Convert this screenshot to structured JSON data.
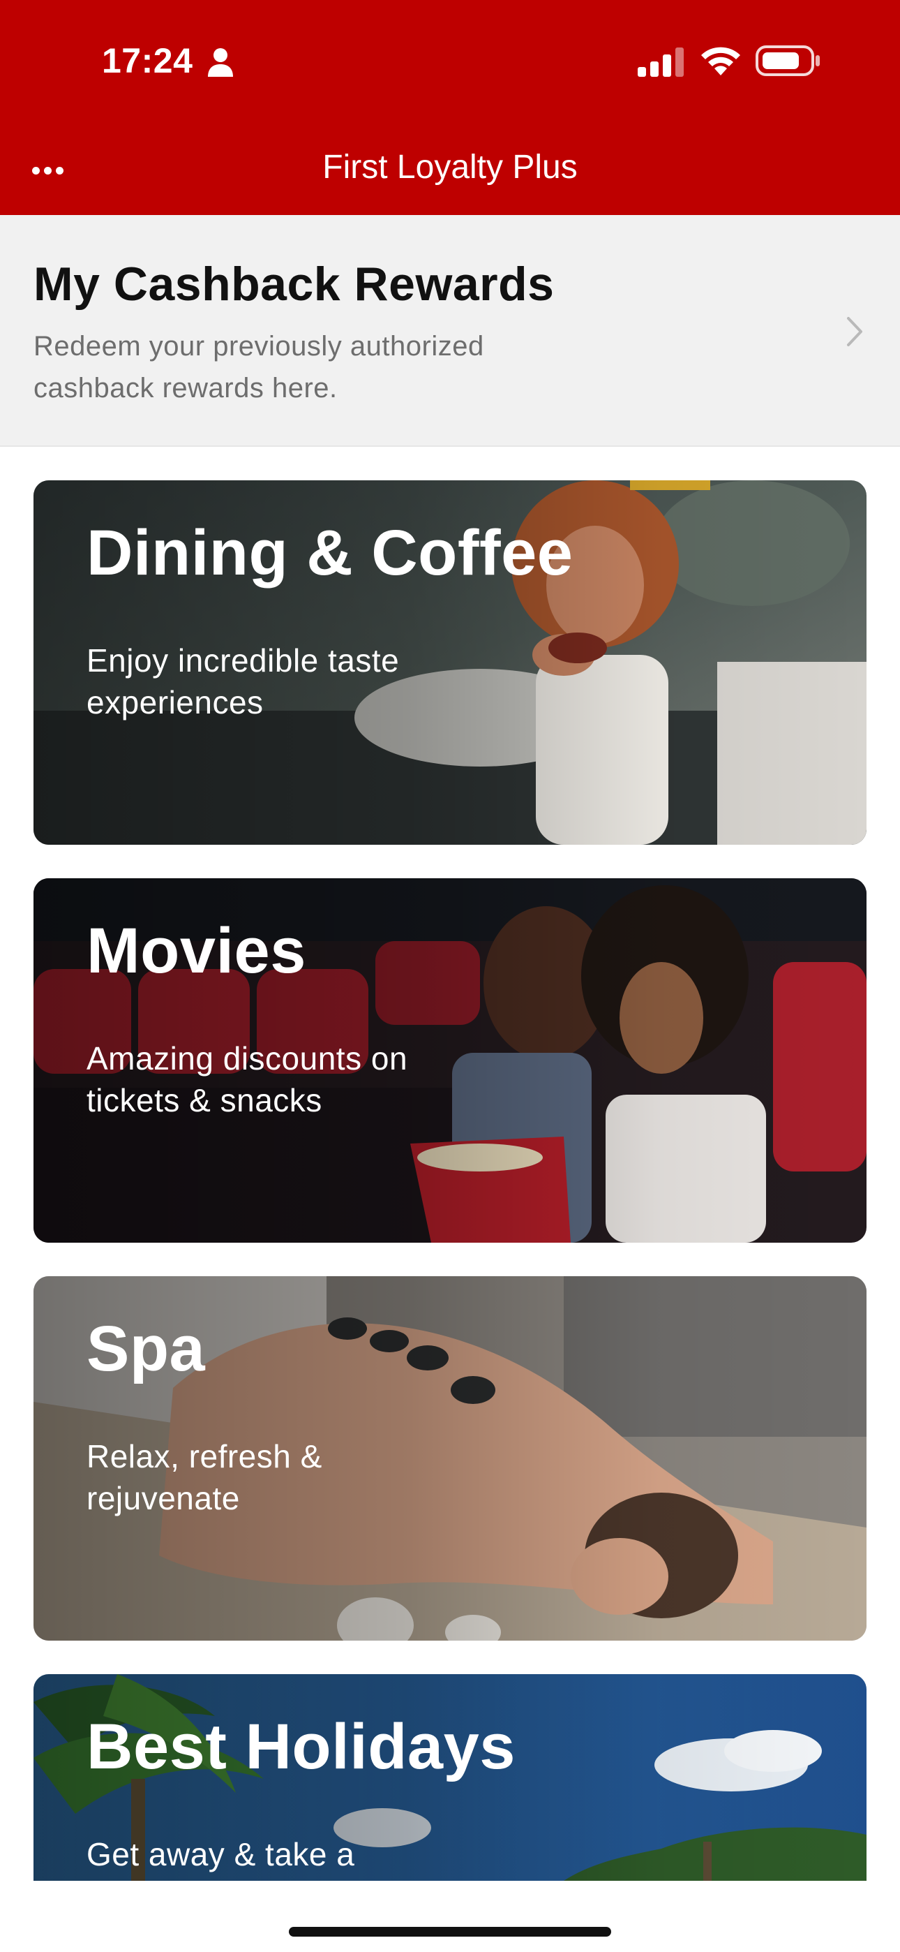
{
  "status_bar": {
    "time": "17:24"
  },
  "header": {
    "title": "First Loyalty Plus",
    "more_icon": "more-horizontal-icon",
    "color": "#be0000"
  },
  "cashback": {
    "title": "My Cashback Rewards",
    "description": "Redeem your previously authorized cashback rewards here."
  },
  "categories": [
    {
      "title": "Dining & Coffee",
      "description": "Enjoy incredible taste experiences"
    },
    {
      "title": "Movies",
      "description": "Amazing discounts on tickets & snacks"
    },
    {
      "title": "Spa",
      "description": "Relax, refresh & rejuvenate"
    },
    {
      "title": "Best Holidays",
      "description": "Get away & take a"
    }
  ]
}
